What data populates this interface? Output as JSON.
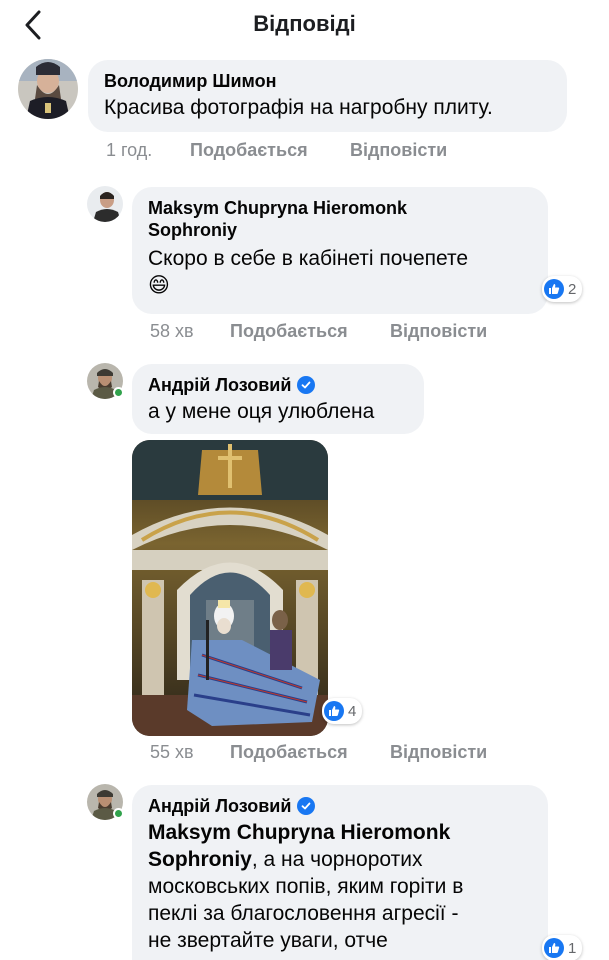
{
  "header": {
    "title": "Відповіді",
    "back_icon": "chevron-left-icon"
  },
  "colors": {
    "like_blue": "#1877f2",
    "bubble_bg": "#f0f2f5",
    "meta_gray": "#8a8d91",
    "online_green": "#31a24c"
  },
  "comments": [
    {
      "author": "Володимир Шимон",
      "text": "Красива фотографія на нагробну плиту.",
      "time": "1 год.",
      "like_label": "Подобається",
      "reply_label": "Відповісти"
    },
    {
      "author_line1": "Maksym Chupryna Hieromonk",
      "author_line2": "Sophroniy",
      "text": "Скоро в себе в кабінеті почепете",
      "emoji": "😄",
      "time": "58 хв",
      "like_label": "Подобається",
      "reply_label": "Відповісти",
      "reactions": "2"
    },
    {
      "author": "Андрій Лозовий",
      "text": "а у мене оця улюблена",
      "time": "55 хв",
      "like_label": "Подобається",
      "reply_label": "Відповісти",
      "reactions": "4"
    },
    {
      "author": "Андрій Лозовий",
      "mention_line1": "Maksym Chupryna Hieromonk",
      "mention_line2": "Sophroniy",
      "text_line1": ", а на чорноротих",
      "text_line2": "московських попів, яким горіти в",
      "text_line3": "пеклі за благословення агресії -",
      "text_line4": "не звертайте уваги, отче",
      "reactions": "1"
    }
  ]
}
